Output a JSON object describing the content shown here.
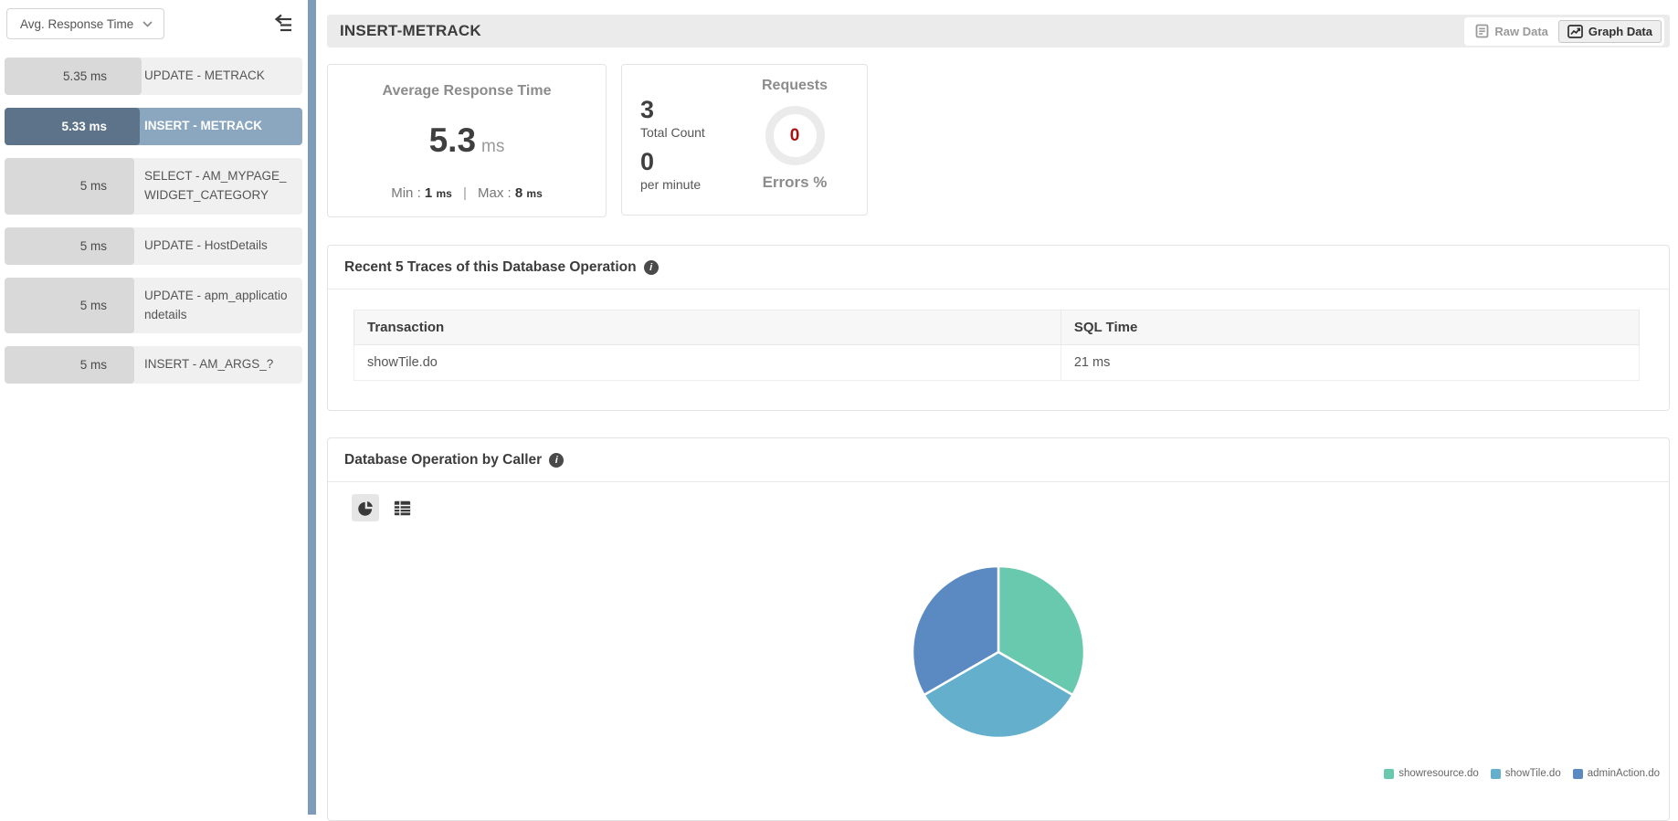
{
  "sidebar": {
    "sort_dropdown": {
      "label": "Avg. Response Time"
    },
    "items": [
      {
        "value": "5.35 ms",
        "label": "UPDATE - METRACK",
        "bar_pct": 46,
        "selected": false
      },
      {
        "value": "5.33 ms",
        "label": "INSERT - METRACK",
        "bar_pct": 45.5,
        "selected": true
      },
      {
        "value": "5 ms",
        "label": "SELECT - AM_MYPAGE_WIDGET_CATEGORY",
        "bar_pct": 43.5,
        "selected": false
      },
      {
        "value": "5 ms",
        "label": "UPDATE - HostDetails",
        "bar_pct": 43.5,
        "selected": false
      },
      {
        "value": "5 ms",
        "label": "UPDATE - apm_applicationdetails",
        "bar_pct": 43.5,
        "selected": false
      },
      {
        "value": "5 ms",
        "label": "INSERT - AM_ARGS_?",
        "bar_pct": 43.5,
        "selected": false
      }
    ]
  },
  "header": {
    "title": "INSERT-METRACK",
    "raw_data_label": "Raw Data",
    "graph_data_label": "Graph Data"
  },
  "cards": {
    "avg_response": {
      "title": "Average Response Time",
      "value": "5.3",
      "unit": "ms",
      "min_label": "Min :",
      "min_value": "1",
      "min_unit": "ms",
      "separator": "|",
      "max_label": "Max :",
      "max_value": "8",
      "max_unit": "ms"
    },
    "requests": {
      "title": "Requests",
      "total_count": "3",
      "total_count_label": "Total Count",
      "per_minute": "0",
      "per_minute_label": "per minute",
      "errors_value": "0",
      "errors_label": "Errors %"
    }
  },
  "traces": {
    "title": "Recent 5 Traces of this Database Operation",
    "info_icon": "info-icon",
    "columns": [
      "Transaction",
      "SQL Time"
    ],
    "rows": [
      {
        "transaction": "showTile.do",
        "sql_time": "21 ms"
      }
    ]
  },
  "caller": {
    "title": "Database Operation by Caller",
    "info_icon": "info-icon",
    "toggles": [
      "pie-chart-view",
      "table-view"
    ]
  },
  "chart_data": {
    "type": "pie",
    "title": "Database Operation by Caller",
    "labels": [
      "showresource.do",
      "showTile.do",
      "adminAction.do"
    ],
    "values": [
      1,
      1,
      1
    ],
    "percentages": [
      33.33,
      33.33,
      33.33
    ],
    "colors": [
      "#68c9ae",
      "#64b0cc",
      "#5a8ac1"
    ],
    "start_angle": "top",
    "direction": "clockwise",
    "legend_position": "bottom-right"
  },
  "colors": {
    "splitter_blue": "#7e9cba",
    "selected_item_dark": "#5d7389",
    "selected_item_light": "#8ba6bf",
    "errors_red": "#aa1111",
    "header_bar_gray": "#ebebeb"
  }
}
